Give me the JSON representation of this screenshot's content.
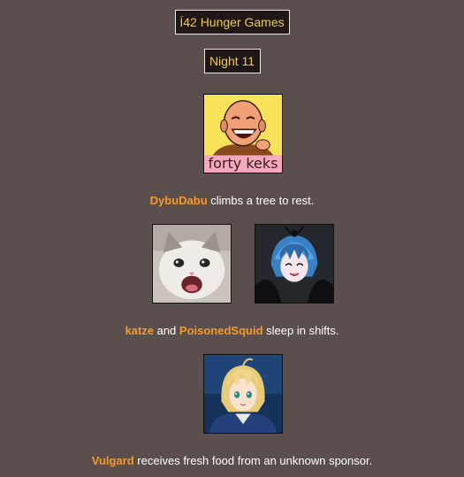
{
  "header": {
    "game_title": "Í42 Hunger Games",
    "night_title": "Night 11"
  },
  "events": [
    {
      "names": [
        "DybuDabu"
      ],
      "text_after": " climbs a tree to rest.",
      "avatars": [
        {
          "caption": "forty keks",
          "icon": "laughing-bald-man-avatar"
        }
      ]
    },
    {
      "names": [
        "katze",
        "PoisonedSquid"
      ],
      "joiner": " and ",
      "text_after": " sleep in shifts.",
      "avatars": [
        {
          "icon": "crying-cat-avatar"
        },
        {
          "icon": "blue-hair-anime-avatar"
        }
      ]
    },
    {
      "names": [
        "Vulgard"
      ],
      "text_after": " receives fresh food from an unknown sponsor.",
      "avatars": [
        {
          "icon": "blonde-anime-knight-avatar"
        }
      ]
    }
  ],
  "colors": {
    "background": "#5b4f4d",
    "title_text": "#f3c843",
    "tribute_name": "#f39a2b",
    "event_text": "#ffffff"
  }
}
